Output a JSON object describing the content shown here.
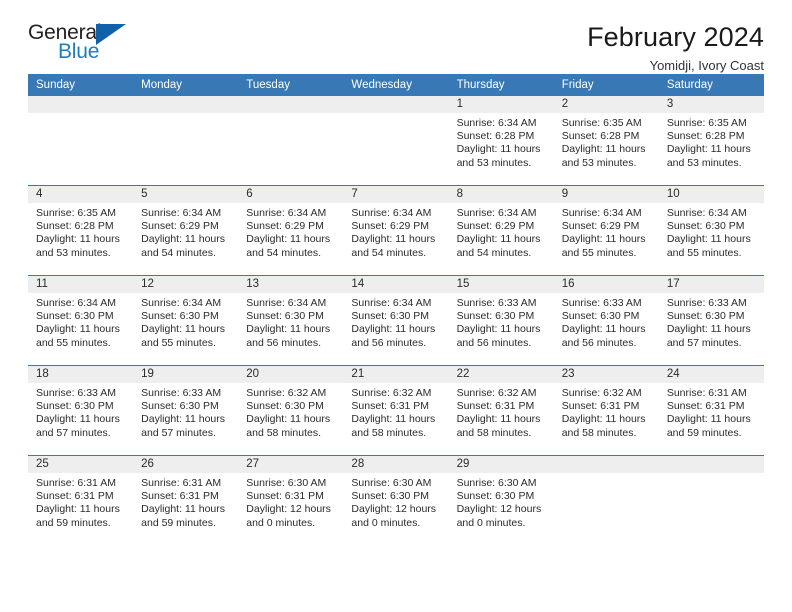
{
  "brand": {
    "name_top": "General",
    "name_bottom": "Blue",
    "triangle_color": "#1061a8",
    "blue_text_color": "#1f7dc0"
  },
  "header": {
    "title": "February 2024",
    "subtitle": "Yomidji, Ivory Coast",
    "header_bg": "#3878b4",
    "daynum_bg": "#eeeeee"
  },
  "weekday_headers": [
    "Sunday",
    "Monday",
    "Tuesday",
    "Wednesday",
    "Thursday",
    "Friday",
    "Saturday"
  ],
  "labels": {
    "sunrise_prefix": "Sunrise:",
    "sunset_prefix": "Sunset:",
    "daylight_prefix": "Daylight:"
  },
  "weeks": [
    [
      {
        "day": "",
        "empty": true
      },
      {
        "day": "",
        "empty": true
      },
      {
        "day": "",
        "empty": true
      },
      {
        "day": "",
        "empty": true
      },
      {
        "day": "1",
        "sunrise": "Sunrise: 6:34 AM",
        "sunset": "Sunset: 6:28 PM",
        "daylight_line1": "Daylight: 11 hours",
        "daylight_line2": "and 53 minutes."
      },
      {
        "day": "2",
        "sunrise": "Sunrise: 6:35 AM",
        "sunset": "Sunset: 6:28 PM",
        "daylight_line1": "Daylight: 11 hours",
        "daylight_line2": "and 53 minutes."
      },
      {
        "day": "3",
        "sunrise": "Sunrise: 6:35 AM",
        "sunset": "Sunset: 6:28 PM",
        "daylight_line1": "Daylight: 11 hours",
        "daylight_line2": "and 53 minutes."
      }
    ],
    [
      {
        "day": "4",
        "sunrise": "Sunrise: 6:35 AM",
        "sunset": "Sunset: 6:28 PM",
        "daylight_line1": "Daylight: 11 hours",
        "daylight_line2": "and 53 minutes."
      },
      {
        "day": "5",
        "sunrise": "Sunrise: 6:34 AM",
        "sunset": "Sunset: 6:29 PM",
        "daylight_line1": "Daylight: 11 hours",
        "daylight_line2": "and 54 minutes."
      },
      {
        "day": "6",
        "sunrise": "Sunrise: 6:34 AM",
        "sunset": "Sunset: 6:29 PM",
        "daylight_line1": "Daylight: 11 hours",
        "daylight_line2": "and 54 minutes."
      },
      {
        "day": "7",
        "sunrise": "Sunrise: 6:34 AM",
        "sunset": "Sunset: 6:29 PM",
        "daylight_line1": "Daylight: 11 hours",
        "daylight_line2": "and 54 minutes."
      },
      {
        "day": "8",
        "sunrise": "Sunrise: 6:34 AM",
        "sunset": "Sunset: 6:29 PM",
        "daylight_line1": "Daylight: 11 hours",
        "daylight_line2": "and 54 minutes."
      },
      {
        "day": "9",
        "sunrise": "Sunrise: 6:34 AM",
        "sunset": "Sunset: 6:29 PM",
        "daylight_line1": "Daylight: 11 hours",
        "daylight_line2": "and 55 minutes."
      },
      {
        "day": "10",
        "sunrise": "Sunrise: 6:34 AM",
        "sunset": "Sunset: 6:30 PM",
        "daylight_line1": "Daylight: 11 hours",
        "daylight_line2": "and 55 minutes."
      }
    ],
    [
      {
        "day": "11",
        "sunrise": "Sunrise: 6:34 AM",
        "sunset": "Sunset: 6:30 PM",
        "daylight_line1": "Daylight: 11 hours",
        "daylight_line2": "and 55 minutes."
      },
      {
        "day": "12",
        "sunrise": "Sunrise: 6:34 AM",
        "sunset": "Sunset: 6:30 PM",
        "daylight_line1": "Daylight: 11 hours",
        "daylight_line2": "and 55 minutes."
      },
      {
        "day": "13",
        "sunrise": "Sunrise: 6:34 AM",
        "sunset": "Sunset: 6:30 PM",
        "daylight_line1": "Daylight: 11 hours",
        "daylight_line2": "and 56 minutes."
      },
      {
        "day": "14",
        "sunrise": "Sunrise: 6:34 AM",
        "sunset": "Sunset: 6:30 PM",
        "daylight_line1": "Daylight: 11 hours",
        "daylight_line2": "and 56 minutes."
      },
      {
        "day": "15",
        "sunrise": "Sunrise: 6:33 AM",
        "sunset": "Sunset: 6:30 PM",
        "daylight_line1": "Daylight: 11 hours",
        "daylight_line2": "and 56 minutes."
      },
      {
        "day": "16",
        "sunrise": "Sunrise: 6:33 AM",
        "sunset": "Sunset: 6:30 PM",
        "daylight_line1": "Daylight: 11 hours",
        "daylight_line2": "and 56 minutes."
      },
      {
        "day": "17",
        "sunrise": "Sunrise: 6:33 AM",
        "sunset": "Sunset: 6:30 PM",
        "daylight_line1": "Daylight: 11 hours",
        "daylight_line2": "and 57 minutes."
      }
    ],
    [
      {
        "day": "18",
        "sunrise": "Sunrise: 6:33 AM",
        "sunset": "Sunset: 6:30 PM",
        "daylight_line1": "Daylight: 11 hours",
        "daylight_line2": "and 57 minutes."
      },
      {
        "day": "19",
        "sunrise": "Sunrise: 6:33 AM",
        "sunset": "Sunset: 6:30 PM",
        "daylight_line1": "Daylight: 11 hours",
        "daylight_line2": "and 57 minutes."
      },
      {
        "day": "20",
        "sunrise": "Sunrise: 6:32 AM",
        "sunset": "Sunset: 6:30 PM",
        "daylight_line1": "Daylight: 11 hours",
        "daylight_line2": "and 58 minutes."
      },
      {
        "day": "21",
        "sunrise": "Sunrise: 6:32 AM",
        "sunset": "Sunset: 6:31 PM",
        "daylight_line1": "Daylight: 11 hours",
        "daylight_line2": "and 58 minutes."
      },
      {
        "day": "22",
        "sunrise": "Sunrise: 6:32 AM",
        "sunset": "Sunset: 6:31 PM",
        "daylight_line1": "Daylight: 11 hours",
        "daylight_line2": "and 58 minutes."
      },
      {
        "day": "23",
        "sunrise": "Sunrise: 6:32 AM",
        "sunset": "Sunset: 6:31 PM",
        "daylight_line1": "Daylight: 11 hours",
        "daylight_line2": "and 58 minutes."
      },
      {
        "day": "24",
        "sunrise": "Sunrise: 6:31 AM",
        "sunset": "Sunset: 6:31 PM",
        "daylight_line1": "Daylight: 11 hours",
        "daylight_line2": "and 59 minutes."
      }
    ],
    [
      {
        "day": "25",
        "sunrise": "Sunrise: 6:31 AM",
        "sunset": "Sunset: 6:31 PM",
        "daylight_line1": "Daylight: 11 hours",
        "daylight_line2": "and 59 minutes."
      },
      {
        "day": "26",
        "sunrise": "Sunrise: 6:31 AM",
        "sunset": "Sunset: 6:31 PM",
        "daylight_line1": "Daylight: 11 hours",
        "daylight_line2": "and 59 minutes."
      },
      {
        "day": "27",
        "sunrise": "Sunrise: 6:30 AM",
        "sunset": "Sunset: 6:31 PM",
        "daylight_line1": "Daylight: 12 hours",
        "daylight_line2": "and 0 minutes."
      },
      {
        "day": "28",
        "sunrise": "Sunrise: 6:30 AM",
        "sunset": "Sunset: 6:30 PM",
        "daylight_line1": "Daylight: 12 hours",
        "daylight_line2": "and 0 minutes."
      },
      {
        "day": "29",
        "sunrise": "Sunrise: 6:30 AM",
        "sunset": "Sunset: 6:30 PM",
        "daylight_line1": "Daylight: 12 hours",
        "daylight_line2": "and 0 minutes."
      },
      {
        "day": "",
        "empty": true
      },
      {
        "day": "",
        "empty": true
      }
    ]
  ]
}
